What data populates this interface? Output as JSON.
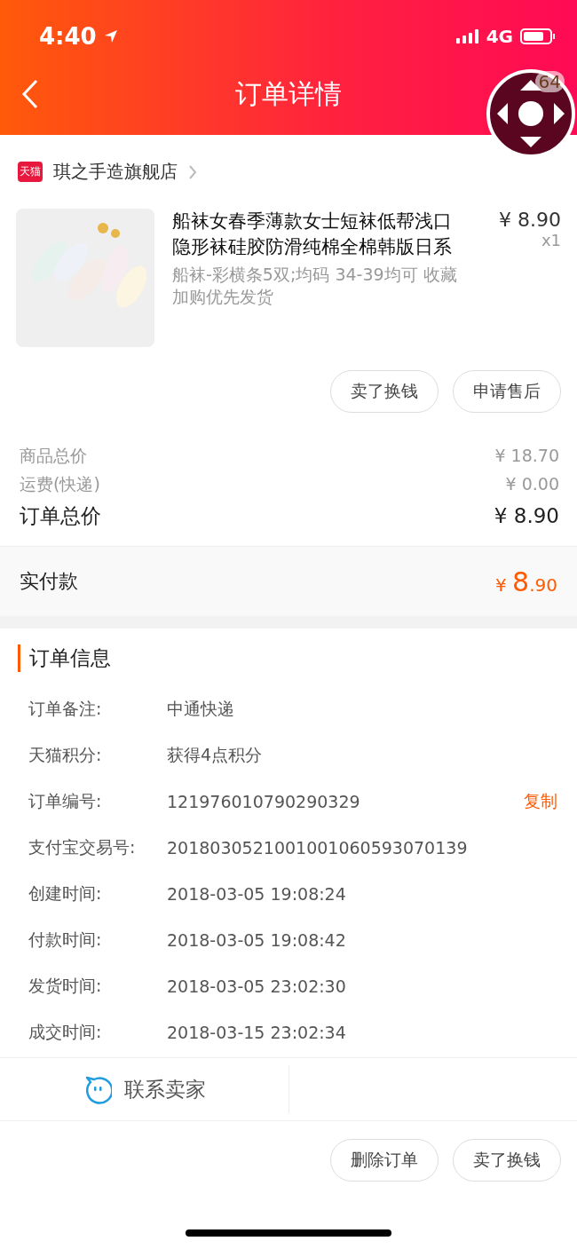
{
  "status_bar": {
    "time": "4:40",
    "network": "4G"
  },
  "nav": {
    "title": "订单详情",
    "badge": "64"
  },
  "store": {
    "name": "琪之手造旗舰店",
    "logo": "天猫"
  },
  "product": {
    "kind": "picture",
    "title": "船袜女春季薄款女士短袜低帮浅口隐形袜硅胶防滑纯棉全棉韩版日系",
    "sku": "船袜-彩横条5双;均码 34-39均可 收藏加购优先发货",
    "price": "¥ 8.90",
    "quantity": "x1"
  },
  "item_actions": [
    "卖了换钱",
    "申请售后"
  ],
  "summary": [
    {
      "label": "商品总价",
      "value": "¥ 18.70",
      "kind": "minor"
    },
    {
      "label": "运费(快递)",
      "value": "¥ 0.00",
      "kind": "minor"
    },
    {
      "label": "订单总价",
      "value": "¥ 8.90",
      "kind": "major"
    }
  ],
  "paid": {
    "label": "实付款",
    "currency": "¥ ",
    "integer": "8",
    "decimal": ".90"
  },
  "order_info": {
    "title": "订单信息",
    "rows": [
      {
        "label": "订单备注:",
        "value": "中通快递"
      },
      {
        "label": "天猫积分:",
        "value": "获得4点积分"
      },
      {
        "label": "订单编号:",
        "value": "121976010790290329",
        "action": "复制"
      },
      {
        "label": "支付宝交易号:",
        "value": "2018030521001001060593070139"
      },
      {
        "label": "创建时间:",
        "value": "2018-03-05 19:08:24"
      },
      {
        "label": "付款时间:",
        "value": "2018-03-05 19:08:42"
      },
      {
        "label": "发货时间:",
        "value": "2018-03-05 23:02:30"
      },
      {
        "label": "成交时间:",
        "value": "2018-03-15 23:02:34"
      }
    ]
  },
  "contact": {
    "label": "联系卖家"
  },
  "bottom_actions": [
    "删除订单",
    "卖了换钱"
  ]
}
